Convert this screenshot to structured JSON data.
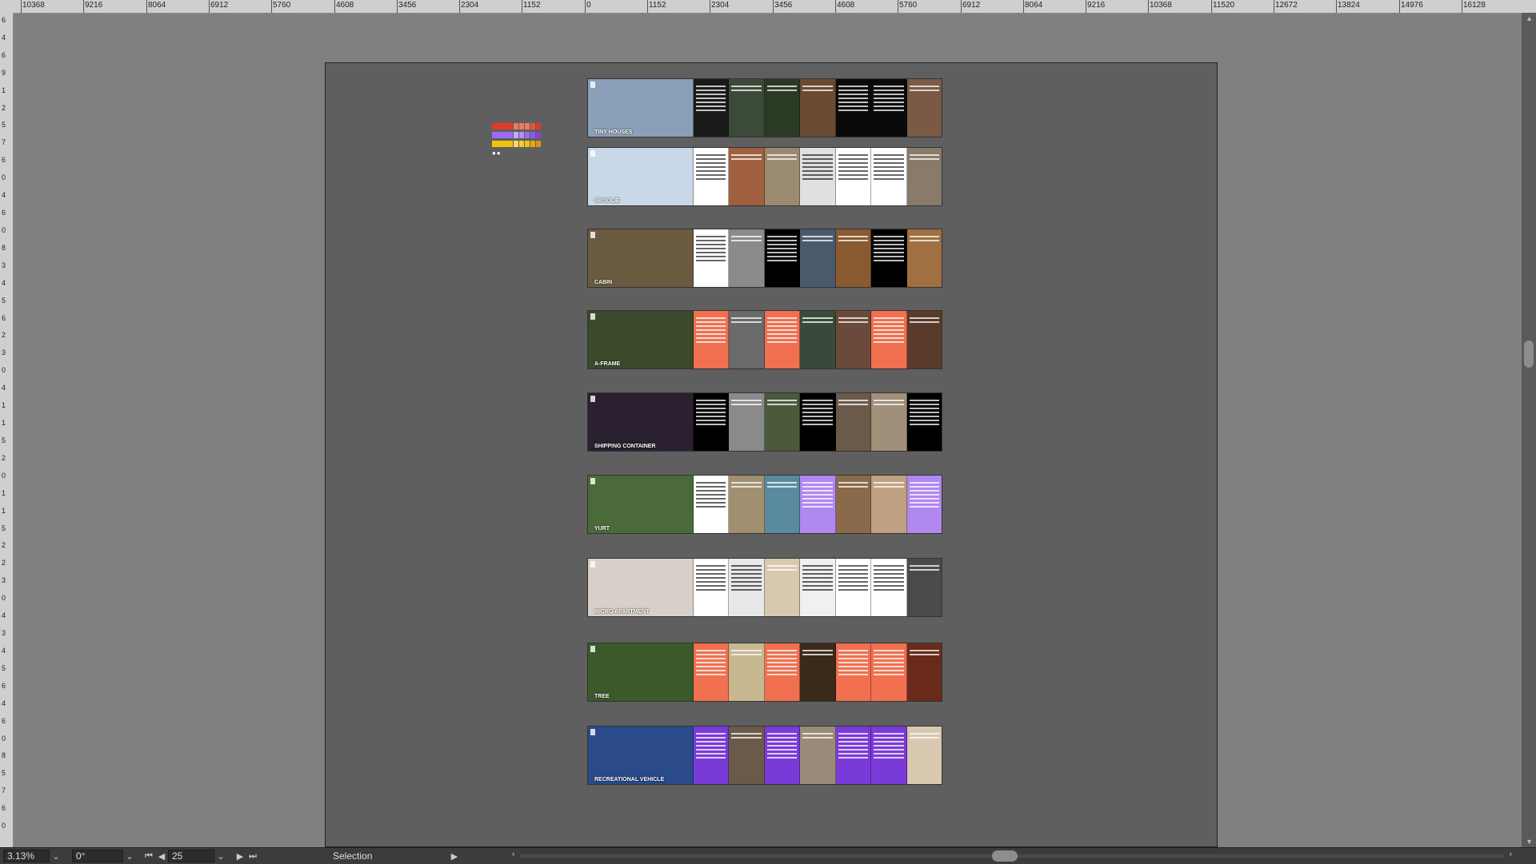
{
  "ruler_top": {
    "labels": [
      "10368",
      "9216",
      "8064",
      "6912",
      "5760",
      "4608",
      "3456",
      "2304",
      "1152",
      "0",
      "1152",
      "2304",
      "3456",
      "4608",
      "5760",
      "6912",
      "8064",
      "9216",
      "10368",
      "11520",
      "12672",
      "13824",
      "14976",
      "16128"
    ]
  },
  "ruler_left": {
    "labels": [
      "6",
      "4",
      "6",
      "9",
      "1",
      "2",
      "5",
      "7",
      "6",
      "0",
      "4",
      "6",
      "0",
      "8",
      "3",
      "4",
      "5",
      "6",
      "2",
      "3",
      "0",
      "4",
      "1",
      "1",
      "5",
      "2",
      "0",
      "1",
      "1",
      "5",
      "2",
      "2",
      "3",
      "0",
      "4",
      "3",
      "4",
      "5",
      "6",
      "4",
      "6",
      "0",
      "8",
      "5",
      "7",
      "6",
      "0"
    ]
  },
  "swatches": {
    "rows": [
      {
        "colors": [
          "#e03a2a",
          "#f07860",
          "#f07860",
          "#f07860",
          "#e85040",
          "#e03a2a"
        ]
      },
      {
        "colors": [
          "#9a6cf0",
          "#c8a8f8",
          "#b490f4",
          "#9a6cf0",
          "#8a5ae8",
          "#7a4ad8"
        ]
      },
      {
        "colors": [
          "#f2c210",
          "#f8dc60",
          "#f5cf30",
          "#f2c210",
          "#e8a810",
          "#e09010"
        ]
      }
    ]
  },
  "spreads": [
    {
      "title": "TINY HOUSES",
      "accent": "#000000",
      "colors": [
        "#8aa0b8",
        "#1a1a1a",
        "#3c4a3a",
        "#2a3a24",
        "#6a4a30",
        "#0a0a0a",
        "#0a0a0a",
        "#7a5a44"
      ]
    },
    {
      "title": "SKOOLIE",
      "accent": "#000000",
      "colors": [
        "#c8d8e8",
        "#ffffff",
        "#a06040",
        "#9a8a70",
        "#e0e0e0",
        "#ffffff",
        "#ffffff",
        "#8a7a6a"
      ]
    },
    {
      "title": "CABIN",
      "accent": "#000000",
      "colors": [
        "#6a5a40",
        "#ffffff",
        "#8a8a8a",
        "#000000",
        "#4a5a6a",
        "#8a5a30",
        "#000000",
        "#a07040"
      ]
    },
    {
      "title": "A-FRAME",
      "accent": "#f07050",
      "colors": [
        "#3a4a2a",
        "#f07050",
        "#6a6a6a",
        "#f07050",
        "#3a4a3a",
        "#6a4a3a",
        "#f07050",
        "#5a3a2a"
      ]
    },
    {
      "title": "SHIPPING CONTAINER",
      "accent": "#000000",
      "colors": [
        "#2a2030",
        "#000000",
        "#8a8a8a",
        "#4a5a3a",
        "#000000",
        "#6a5a4a",
        "#a0907a",
        "#000000"
      ]
    },
    {
      "title": "YURT",
      "accent": "#b088f0",
      "colors": [
        "#4a6a3a",
        "#ffffff",
        "#a09070",
        "#5a8aa0",
        "#b088f0",
        "#8a6a4a",
        "#c0a080",
        "#b088f0"
      ]
    },
    {
      "title": "MICRO APARTMENT",
      "accent": "#ffffff",
      "colors": [
        "#d8d0c8",
        "#ffffff",
        "#e8e8e8",
        "#d8c8b0",
        "#f0f0f0",
        "#ffffff",
        "#ffffff",
        "#4a4a4a"
      ]
    },
    {
      "title": "TREE",
      "accent": "#f07050",
      "colors": [
        "#3a5a2a",
        "#f07050",
        "#c8b890",
        "#f07050",
        "#3a2a1a",
        "#f07050",
        "#f07050",
        "#6a2a1a"
      ]
    },
    {
      "title": "RECREATIONAL VEHICLE",
      "accent": "#7a3ad8",
      "colors": [
        "#2a4a8a",
        "#7a3ad8",
        "#6a5a4a",
        "#7a3ad8",
        "#9a8a7a",
        "#7a3ad8",
        "#7a3ad8",
        "#d8c8b0"
      ]
    }
  ],
  "statusbar": {
    "zoom": "3.13%",
    "rotation": "0°",
    "page_number": "25",
    "tool": "Selection"
  }
}
